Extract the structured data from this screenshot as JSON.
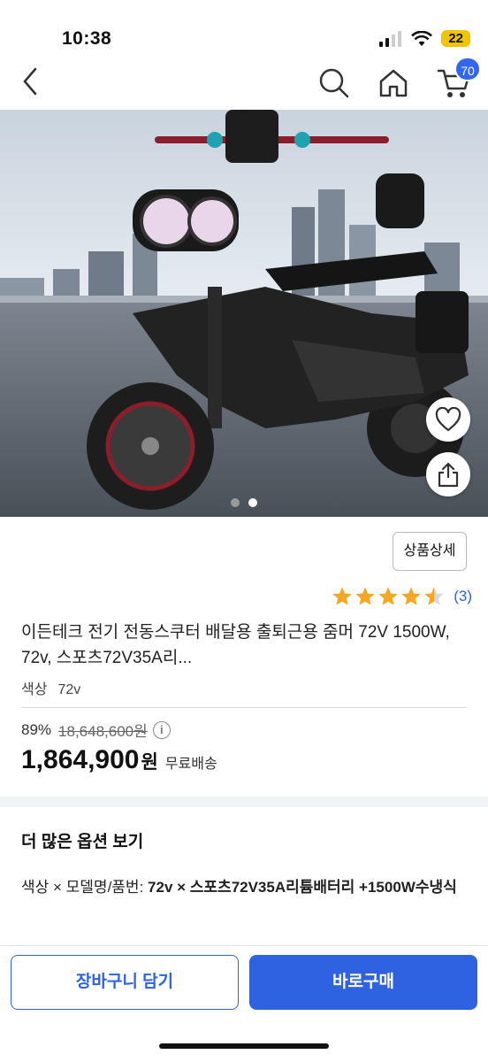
{
  "status": {
    "time": "10:38",
    "battery": "22"
  },
  "nav": {
    "cart_count": "70"
  },
  "carousel": {
    "total": 2,
    "active": 1
  },
  "product": {
    "detail_button": "상품상세",
    "rating_value": 4.5,
    "rating_count": "(3)",
    "title": "이든테크 전기 전동스쿠터 배달용 출퇴근용 줌머 72V 1500W, 72v, 스포츠72V35A리...",
    "option_label": "색상",
    "option_value": "72v",
    "discount": "89%",
    "original_price": "18,648,600원",
    "price": "1,864,900",
    "currency": "원",
    "shipping": "무료배송"
  },
  "more_options": {
    "title": "더 많은 옵션 보기",
    "label": "색상 × 모델명/품번: ",
    "value": "72v × 스포츠72V35A리튬배터리 +1500W수냉식"
  },
  "actions": {
    "cart": "장바구니 담기",
    "buy": "바로구매"
  },
  "colors": {
    "accent": "#2f62e0",
    "star": "#f5a623"
  }
}
